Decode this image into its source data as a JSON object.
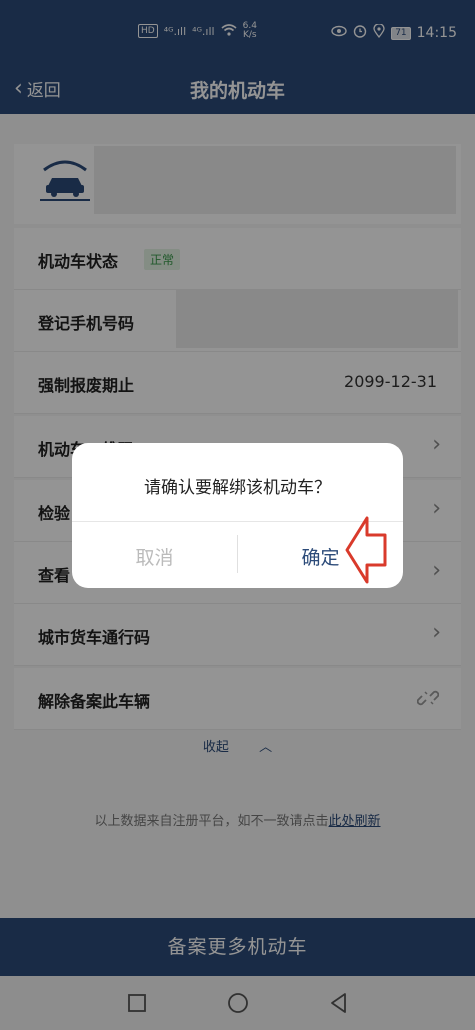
{
  "status_bar": {
    "network_badge": "HD",
    "signal_1": "⁴ᴳ.ıll",
    "signal_2": "⁴ᴳ.ıll",
    "speed_value": "6.4",
    "speed_unit": "K/s",
    "battery": "71",
    "time": "14:15"
  },
  "header": {
    "back_label": "返回",
    "title": "我的机动车"
  },
  "vehicle": {
    "status_label": "机动车状态",
    "status_badge": "正常",
    "phone_label": "登记手机号码",
    "scrap_label": "强制报废期止",
    "scrap_value": "2099-12-31",
    "qr_label": "机动车二维码",
    "inspect_label": "检验",
    "view_label": "查看",
    "city_truck_label": "城市货车通行码",
    "unbind_label": "解除备案此车辆"
  },
  "collapse": {
    "label": "收起",
    "icon": "chevron-up-icon"
  },
  "footer_note": {
    "text": "以上数据来自注册平台，如不一致请点击",
    "link": "此处刷新"
  },
  "bottom_button": {
    "label": "备案更多机动车"
  },
  "dialog": {
    "message": "请确认要解绑该机动车？",
    "cancel_label": "取消",
    "confirm_label": "确定"
  },
  "colors": {
    "brand": "#2c4b79",
    "status_green": "#3a9a4a",
    "hint_arrow": "#d93a2b"
  }
}
